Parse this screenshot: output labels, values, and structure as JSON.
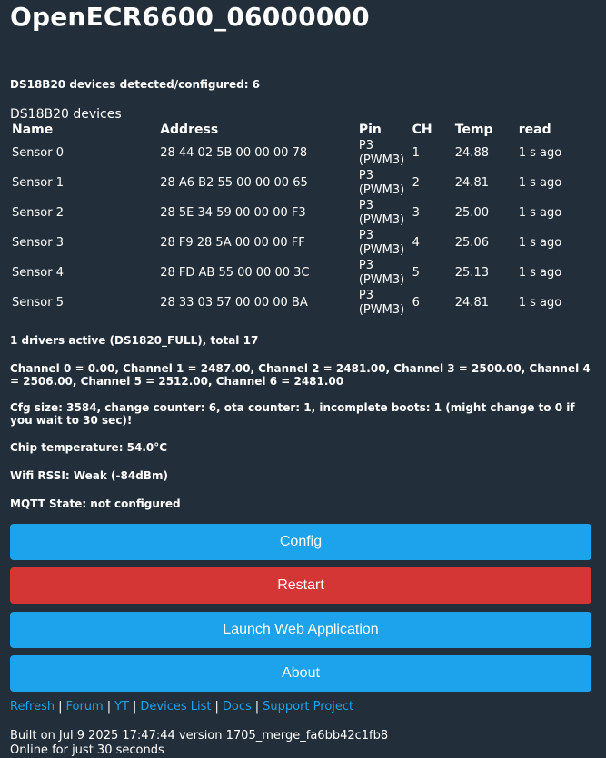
{
  "title": "OpenECR6600_06000000",
  "ds_detected": "DS18B20 devices detected/configured: 6",
  "ds_section_title": "DS18B20 devices",
  "table": {
    "headers": [
      "Name",
      "Address",
      "Pin",
      "CH",
      "Temp",
      "read"
    ],
    "rows": [
      {
        "name": "Sensor 0",
        "address": "28 44 02 5B 00 00 00 78",
        "pin1": "P3",
        "pin2": "(PWM3)",
        "ch": "1",
        "temp": "24.88",
        "read": "1 s ago"
      },
      {
        "name": "Sensor 1",
        "address": "28 A6 B2 55 00 00 00 65",
        "pin1": "P3",
        "pin2": "(PWM3)",
        "ch": "2",
        "temp": "24.81",
        "read": "1 s ago"
      },
      {
        "name": "Sensor 2",
        "address": "28 5E 34 59 00 00 00 F3",
        "pin1": "P3",
        "pin2": "(PWM3)",
        "ch": "3",
        "temp": "25.00",
        "read": "1 s ago"
      },
      {
        "name": "Sensor 3",
        "address": "28 F9 28 5A 00 00 00 FF",
        "pin1": "P3",
        "pin2": "(PWM3)",
        "ch": "4",
        "temp": "25.06",
        "read": "1 s ago"
      },
      {
        "name": "Sensor 4",
        "address": "28 FD AB 55 00 00 00 3C",
        "pin1": "P3",
        "pin2": "(PWM3)",
        "ch": "5",
        "temp": "25.13",
        "read": "1 s ago"
      },
      {
        "name": "Sensor 5",
        "address": "28 33 03 57 00 00 00 BA",
        "pin1": "P3",
        "pin2": "(PWM3)",
        "ch": "6",
        "temp": "24.81",
        "read": "1 s ago"
      }
    ]
  },
  "drivers": "1 drivers active (DS1820_FULL), total 17",
  "channels": "Channel 0 = 0.00, Channel 1 = 2487.00, Channel 2 = 2481.00, Channel 3 = 2500.00, Channel 4 = 2506.00, Channel 5 = 2512.00, Channel 6 = 2481.00",
  "cfg": "Cfg size: 3584, change counter: 6, ota counter: 1, incomplete boots: 1 (might change to 0 if you wait to 30 sec)!",
  "chip_temp": "Chip temperature: 54.0°C",
  "wifi": "Wifi RSSI: Weak (-84dBm)",
  "mqtt": "MQTT State: not configured",
  "buttons": {
    "config": "Config",
    "restart": "Restart",
    "launch": "Launch Web Application",
    "about": "About"
  },
  "links": {
    "refresh": "Refresh",
    "forum": "Forum",
    "yt": "YT",
    "devices_list": "Devices List",
    "docs": "Docs",
    "support": "Support Project",
    "separator": "|"
  },
  "footer": {
    "built": "Built on Jul 9 2025 17:47:44 version 1705_merge_fa6bb42c1fb8",
    "online": "Online for just 30 seconds"
  },
  "colors": {
    "background": "#222e39",
    "accent": "#1ca3ec",
    "danger": "#d43535",
    "text": "#ffffff"
  }
}
